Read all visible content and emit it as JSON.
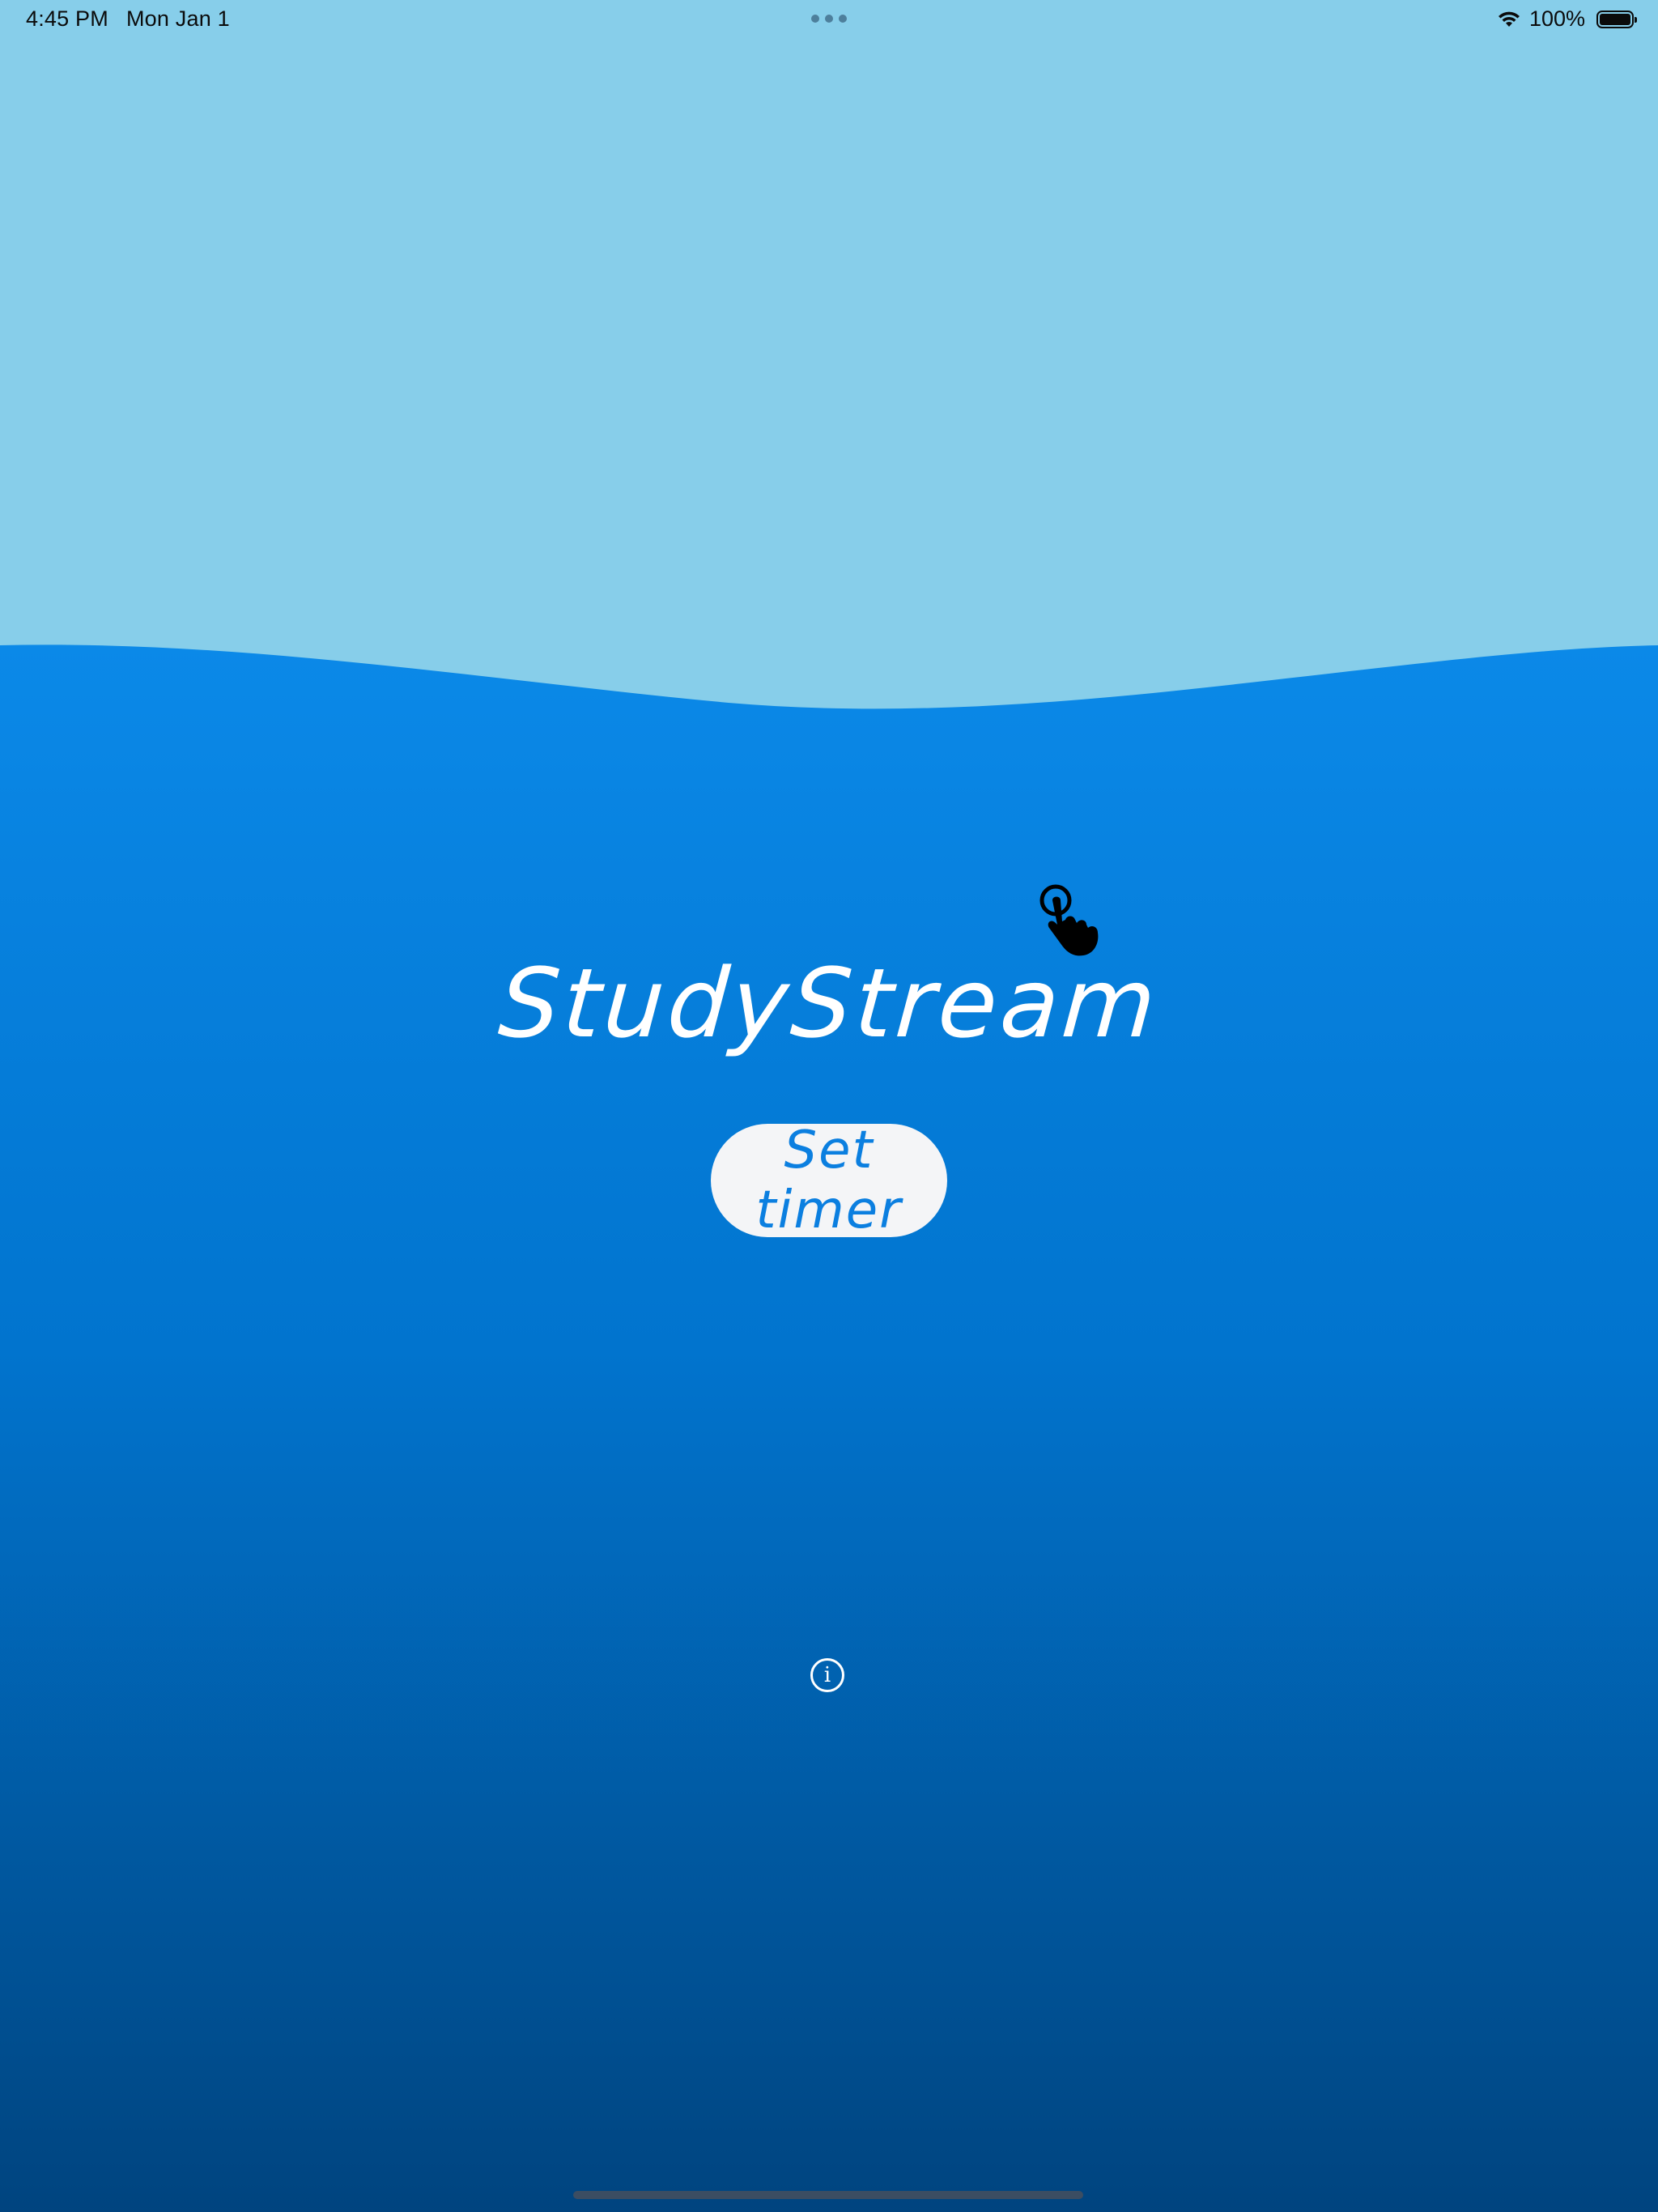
{
  "status_bar": {
    "time": "4:45 PM",
    "date": "Mon Jan 1",
    "battery_percent": "100%",
    "battery_level": 1.0,
    "icons": [
      "wifi-icon",
      "battery-icon",
      "multitasking-dots-icon"
    ]
  },
  "app": {
    "title": "StudyStream",
    "set_timer_label": "Set timer",
    "info_glyph": "i"
  },
  "colors": {
    "sky": "#87CEEA",
    "water_top": "#0B89E8",
    "water_mid": "#0174CE",
    "water_bottom": "#00447F",
    "button_bg": "#F4F5F7",
    "button_text": "#0B7FE0",
    "title_text": "#FFFFFF"
  }
}
